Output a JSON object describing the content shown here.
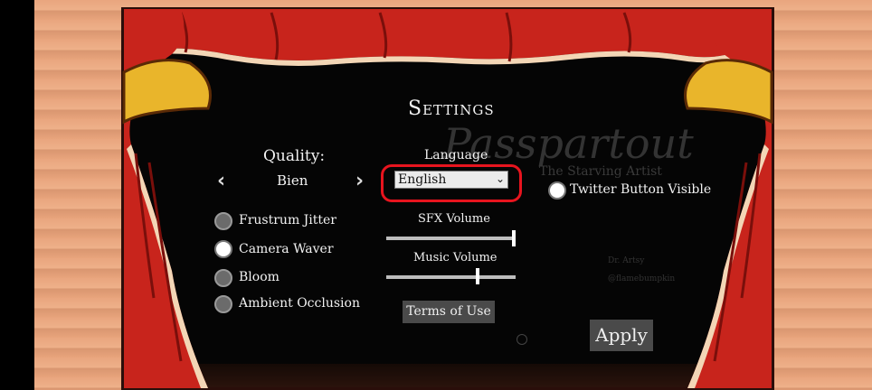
{
  "menu": {
    "title": "Settings",
    "quality": {
      "label": "Quality:",
      "value": "Bien"
    },
    "language": {
      "label": "Language",
      "selected": "English"
    },
    "toggles": [
      {
        "label": "Frustrum Jitter",
        "on": false
      },
      {
        "label": "Camera Waver",
        "on": true
      },
      {
        "label": "Bloom",
        "on": false
      },
      {
        "label": "Ambient Occlusion",
        "on": false
      }
    ],
    "twitter": {
      "label": "Twitter Button Visible",
      "on": true
    },
    "sfx": {
      "label": "SFX Volume",
      "level": 1.0
    },
    "music": {
      "label": "Music Volume",
      "level": 0.7
    },
    "terms_label": "Terms of Use",
    "apply_label": "Apply"
  },
  "background": {
    "logo": "Passpartout",
    "subtitle": "The Starving Artist",
    "credits": [
      "Dr. Artsy",
      "@flamebumpkin"
    ]
  },
  "colors": {
    "curtain_red": "#c8241c",
    "gold": "#e9b52b",
    "highlight": "#e8141e",
    "wall": "#eaa57d"
  }
}
